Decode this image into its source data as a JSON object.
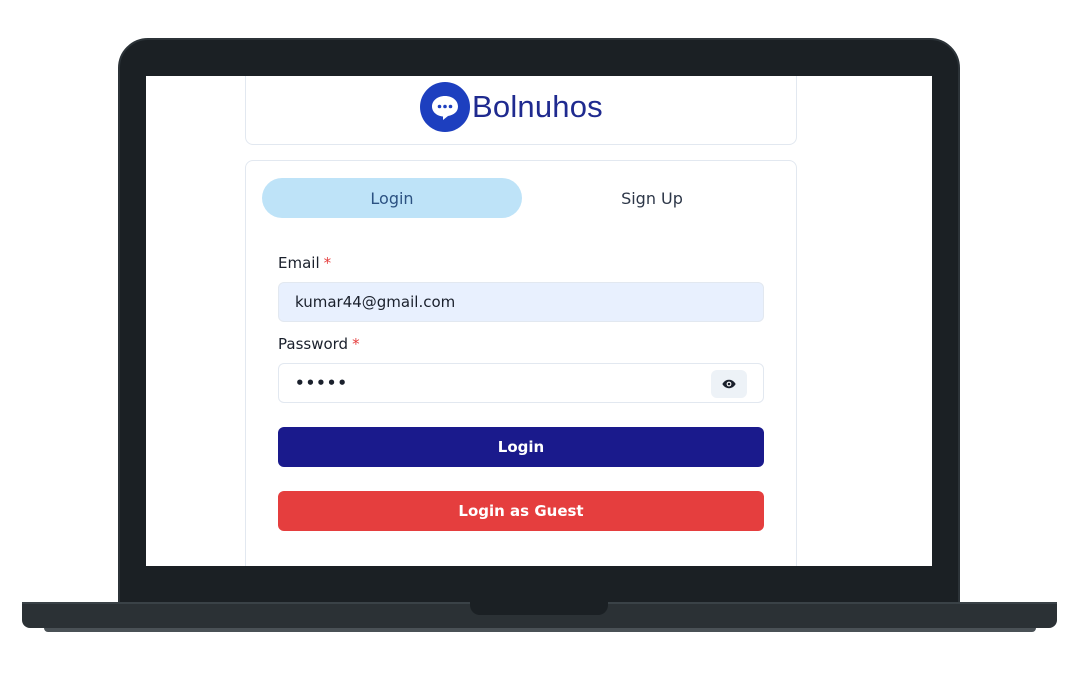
{
  "app": {
    "brand_name": "Bolnuhos",
    "logo_icon": "chat-bubble-icon"
  },
  "tabs": [
    {
      "label": "Login",
      "active": true
    },
    {
      "label": "Sign Up",
      "active": false
    }
  ],
  "form": {
    "email": {
      "label": "Email",
      "required_mark": "*",
      "value": "kumar44@gmail.com"
    },
    "password": {
      "label": "Password",
      "required_mark": "*",
      "masked_value": "•••••",
      "toggle_icon": "eye-icon"
    },
    "login_label": "Login",
    "guest_label": "Login as Guest"
  },
  "colors": {
    "brand_blue": "#1d3fbf",
    "active_tab_bg": "#bee3f8",
    "login_button": "#1a1a8c",
    "guest_button": "#e53e3e",
    "email_field_bg": "#e8f0fe",
    "required_red": "#e53e3e"
  }
}
